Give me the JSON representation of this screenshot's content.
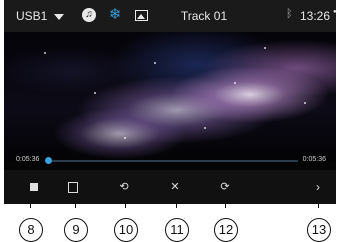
{
  "top_bar": {
    "source": "USB1",
    "source_dropdown_icon": "caret-down-icon",
    "mode_icons": [
      "music-icon",
      "video-icon",
      "photo-icon"
    ],
    "title": "Track 01",
    "bluetooth_icon": "bluetooth-icon",
    "clock": "13:26"
  },
  "player": {
    "elapsed": "0:05:36",
    "total": "0:05:36",
    "progress_fraction": 0.0
  },
  "controls": {
    "icons": [
      "stop-icon",
      "menu-icon",
      "repeat-one-icon",
      "shuffle-icon",
      "repeat-icon",
      "next-icon"
    ]
  },
  "callouts": [
    "8",
    "9",
    "10",
    "11",
    "12",
    "13"
  ],
  "colors": {
    "accent": "#3aa0e0",
    "top_bar_bg": "#1a1a1a",
    "controls_bg": "#111111"
  }
}
